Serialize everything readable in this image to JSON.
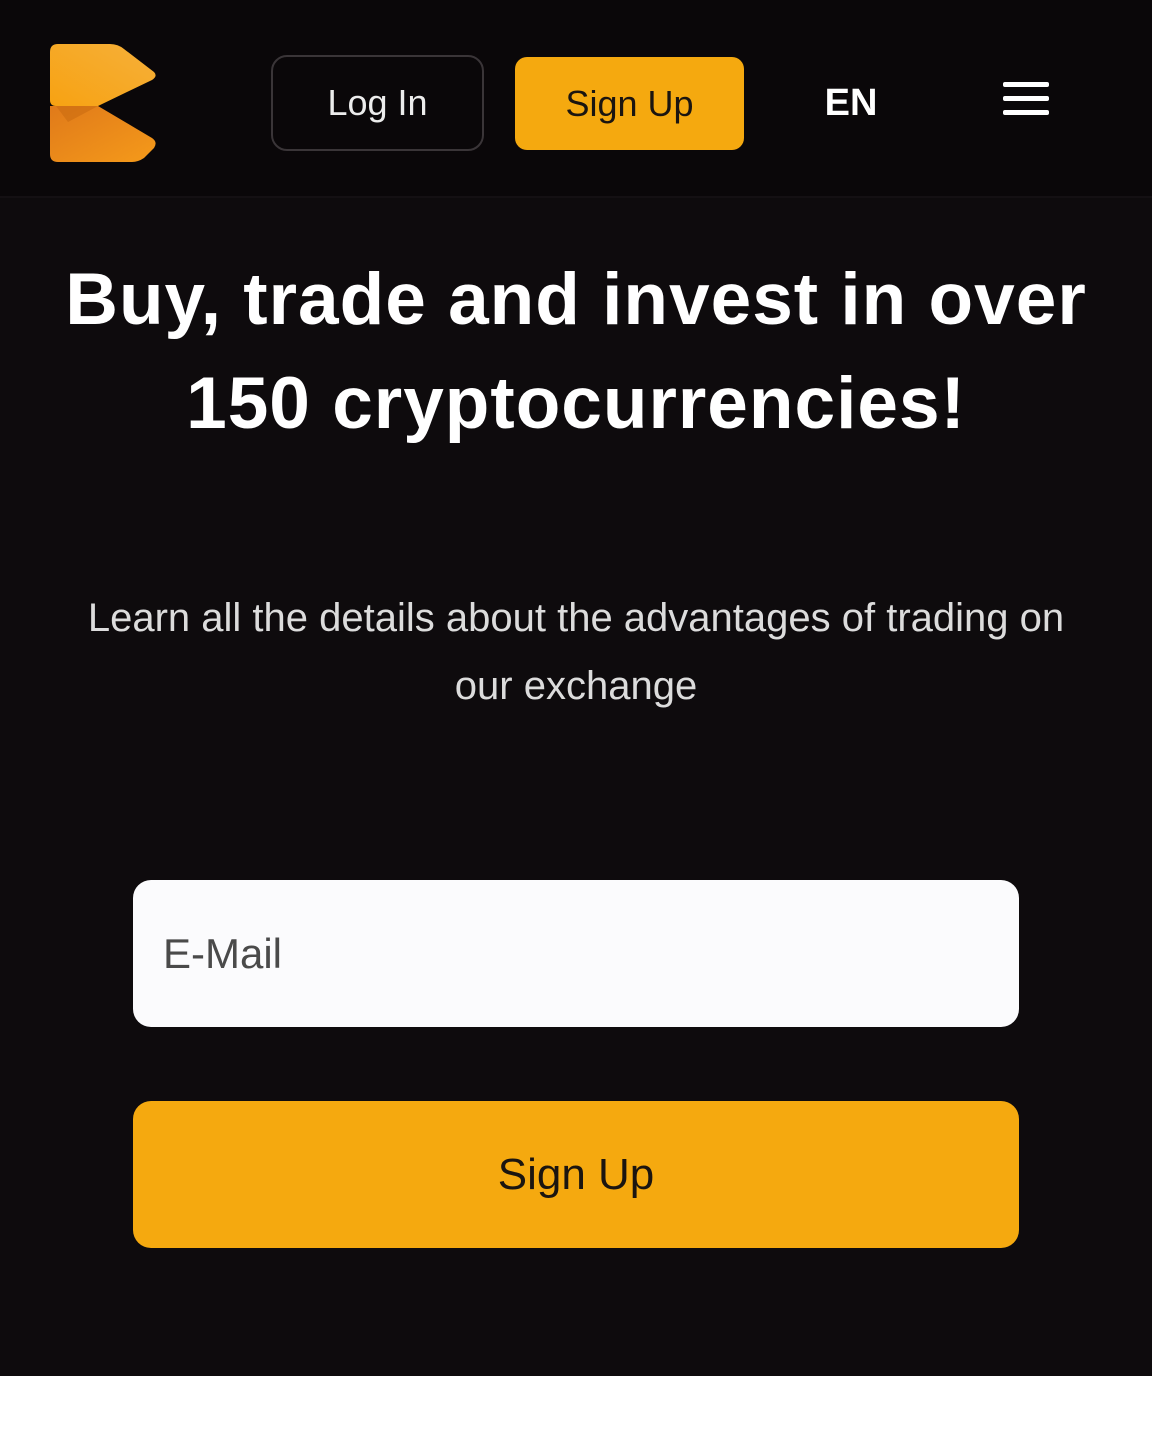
{
  "header": {
    "login_label": "Log In",
    "signup_label": "Sign Up",
    "language": "EN",
    "menu_icon": "hamburger-menu-icon",
    "logo_icon": "exchange-logo-icon"
  },
  "hero": {
    "title": "Buy, trade and invest in over 150 cryptocurrencies!",
    "subtitle": "Learn all the details about the advantages of trading on our exchange"
  },
  "form": {
    "email_placeholder": "E-Mail",
    "email_value": "",
    "signup_label": "Sign Up"
  },
  "colors": {
    "accent": "#f5a90f",
    "background": "#0e0b0d",
    "header_background": "#0a0709"
  }
}
